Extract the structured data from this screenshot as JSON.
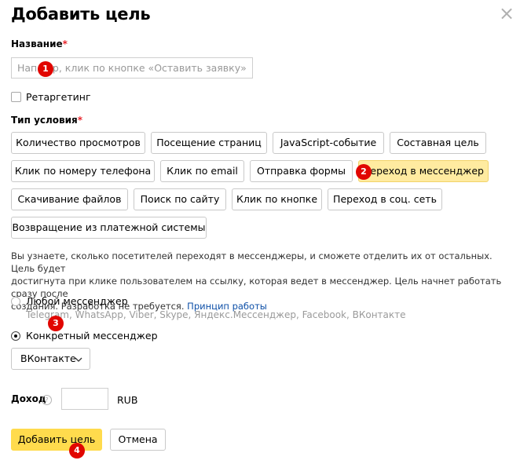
{
  "dialog": {
    "title": "Добавить цель",
    "close_glyph": "×"
  },
  "name_field": {
    "label": "Название",
    "required_mark": "*",
    "placeholder_start": "Нап",
    "placeholder_rest": "ер, клик по кнопке «Оставить заявку»"
  },
  "retargeting": {
    "label": "Ретаргетинг",
    "checked": false
  },
  "condition": {
    "label": "Тип условия",
    "required_mark": "*",
    "options": [
      {
        "label": "Количество просмотров"
      },
      {
        "label": "Посещение страниц"
      },
      {
        "label": "JavaScript-событие"
      },
      {
        "label": "Составная цель"
      },
      {
        "label": "Клик по номеру телефона"
      },
      {
        "label": "Клик по email"
      },
      {
        "label": "Отправка формы"
      },
      {
        "label": "Переход в мессенджер",
        "selected": true
      },
      {
        "label": "Скачивание файлов"
      },
      {
        "label": "Поиск по сайту"
      },
      {
        "label": "Клик по кнопке"
      },
      {
        "label": "Переход в соц. сеть"
      },
      {
        "label": "Возвращение из платежной системы"
      }
    ]
  },
  "description": {
    "line1": "Вы узнаете, сколько посетителей переходят в мессенджеры, и сможете отделить их от остальных. Цель будет",
    "line2": "достигнута при клике пользователем на ссылку, которая ведет в мессенджер. Цель начнет работать сразу после",
    "line3": "создания. Разработка не требуется.",
    "link": "Принцип работы"
  },
  "messenger": {
    "any_label": "Любой мессенджер",
    "any_hint": "Telegram, WhatsApp, Viber, Skype, Яндекс.Мессенджер, Facebook, ВКонтакте",
    "specific_label": "Конкретный мессенджер",
    "selected": "specific",
    "dropdown_value": "ВКонтакте",
    "dropdown_icon": "chevron-down"
  },
  "income": {
    "label": "Доход",
    "help_glyph": "?",
    "value": "",
    "currency": "RUB"
  },
  "actions": {
    "submit": "Добавить цель",
    "cancel": "Отмена"
  },
  "markers": [
    "1",
    "2",
    "3",
    "4"
  ],
  "colors": {
    "accent": "#ffdb4d",
    "selected_option": "#ffeba0",
    "required": "#e8242b",
    "link": "#0d4fa7",
    "marker": "#e10600"
  }
}
